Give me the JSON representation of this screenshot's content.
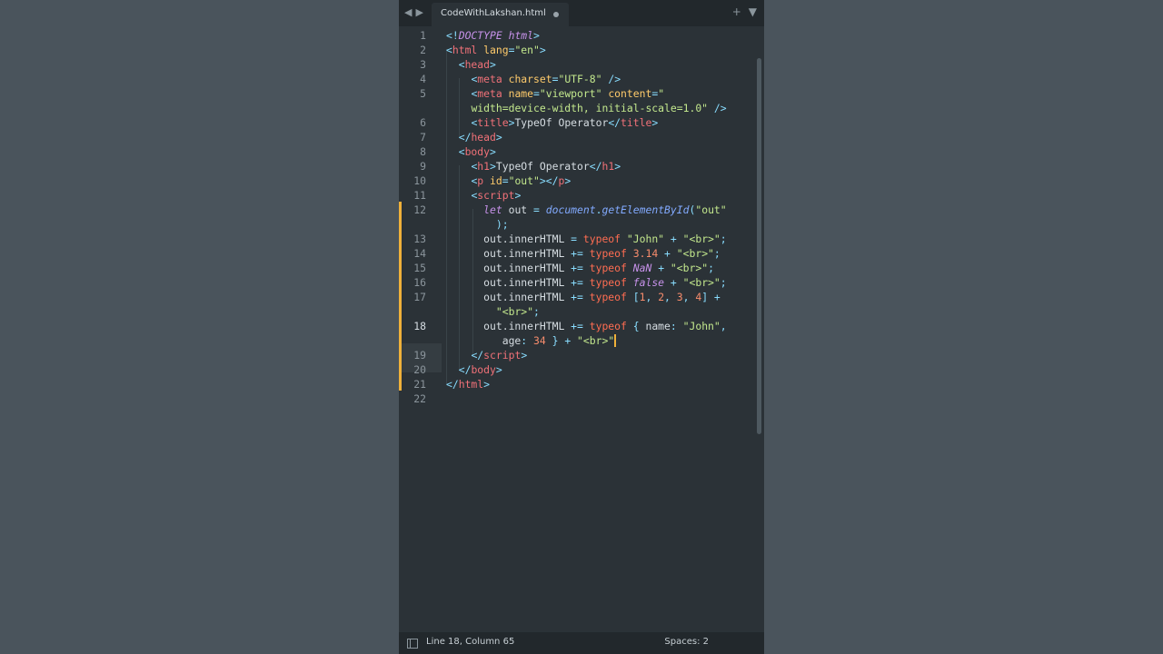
{
  "window": {
    "tab": {
      "title": "CodeWithLakshan.html"
    },
    "icons": [
      "back-arrow-icon",
      "forward-arrow-icon",
      "plus-icon",
      "chevron-down-icon",
      "panel-toggle-icon"
    ]
  },
  "status": {
    "position": "Line 18, Column 65",
    "indent": "Spaces: 2"
  },
  "colors": {
    "tag": "#f07178",
    "attribute": "#ffcb6b",
    "string": "#c3e88d",
    "keyword": "#ff6d52",
    "number": "#f78c6c",
    "modified_marker": "#f0b13a"
  },
  "code": {
    "lines": [
      {
        "num": "1",
        "parts": [
          [
            "p",
            "<!"
          ],
          [
            "i",
            "DOCTYPE"
          ],
          [
            "d",
            " "
          ],
          [
            "i",
            "html"
          ],
          [
            "p",
            ">"
          ]
        ]
      },
      {
        "num": "2",
        "parts": [
          [
            "p",
            "<"
          ],
          [
            "t",
            "html"
          ],
          [
            "d",
            " "
          ],
          [
            "a",
            "lang"
          ],
          [
            "p",
            "="
          ],
          [
            "s",
            "\"en\""
          ],
          [
            "p",
            ">"
          ]
        ]
      },
      {
        "num": "3",
        "parts": [
          [
            "d",
            "  "
          ],
          [
            "p",
            "<"
          ],
          [
            "t",
            "head"
          ],
          [
            "p",
            ">"
          ]
        ]
      },
      {
        "num": "4",
        "parts": [
          [
            "d",
            "    "
          ],
          [
            "p",
            "<"
          ],
          [
            "t",
            "meta"
          ],
          [
            "d",
            " "
          ],
          [
            "a",
            "charset"
          ],
          [
            "p",
            "="
          ],
          [
            "s",
            "\"UTF-8\""
          ],
          [
            "d",
            " "
          ],
          [
            "p",
            "/>"
          ]
        ]
      },
      {
        "num": "5",
        "parts": [
          [
            "d",
            "    "
          ],
          [
            "p",
            "<"
          ],
          [
            "t",
            "meta"
          ],
          [
            "d",
            " "
          ],
          [
            "a",
            "name"
          ],
          [
            "p",
            "="
          ],
          [
            "s",
            "\"viewport\""
          ],
          [
            "d",
            " "
          ],
          [
            "a",
            "content"
          ],
          [
            "p",
            "="
          ],
          [
            "s",
            "\""
          ]
        ]
      },
      {
        "num": "",
        "parts": [
          [
            "d",
            "    "
          ],
          [
            "s",
            "width=device-width, initial-scale=1.0\""
          ],
          [
            "d",
            " "
          ],
          [
            "p",
            "/>"
          ]
        ]
      },
      {
        "num": "6",
        "parts": [
          [
            "d",
            "    "
          ],
          [
            "p",
            "<"
          ],
          [
            "t",
            "title"
          ],
          [
            "p",
            ">"
          ],
          [
            "d",
            "TypeOf Operator"
          ],
          [
            "p",
            "</"
          ],
          [
            "t",
            "title"
          ],
          [
            "p",
            ">"
          ]
        ]
      },
      {
        "num": "7",
        "parts": [
          [
            "d",
            "  "
          ],
          [
            "p",
            "</"
          ],
          [
            "t",
            "head"
          ],
          [
            "p",
            ">"
          ]
        ]
      },
      {
        "num": "8",
        "parts": [
          [
            "d",
            "  "
          ],
          [
            "p",
            "<"
          ],
          [
            "t",
            "body"
          ],
          [
            "p",
            ">"
          ]
        ]
      },
      {
        "num": "9",
        "parts": [
          [
            "d",
            "    "
          ],
          [
            "p",
            "<"
          ],
          [
            "t",
            "h1"
          ],
          [
            "p",
            ">"
          ],
          [
            "d",
            "TypeOf Operator"
          ],
          [
            "p",
            "</"
          ],
          [
            "t",
            "h1"
          ],
          [
            "p",
            ">"
          ]
        ]
      },
      {
        "num": "10",
        "parts": [
          [
            "d",
            "    "
          ],
          [
            "p",
            "<"
          ],
          [
            "t",
            "p"
          ],
          [
            "d",
            " "
          ],
          [
            "a",
            "id"
          ],
          [
            "p",
            "="
          ],
          [
            "s",
            "\"out\""
          ],
          [
            "p",
            "></"
          ],
          [
            "t",
            "p"
          ],
          [
            "p",
            ">"
          ]
        ]
      },
      {
        "num": "11",
        "parts": [
          [
            "d",
            "    "
          ],
          [
            "p",
            "<"
          ],
          [
            "t",
            "script"
          ],
          [
            "p",
            ">"
          ]
        ]
      },
      {
        "num": "12",
        "parts": [
          [
            "d",
            "      "
          ],
          [
            "i",
            "let"
          ],
          [
            "d",
            " out "
          ],
          [
            "p",
            "="
          ],
          [
            "d",
            " "
          ],
          [
            "v",
            "document"
          ],
          [
            "p",
            "."
          ],
          [
            "v",
            "getElementById"
          ],
          [
            "p",
            "("
          ],
          [
            "s",
            "\"out\""
          ]
        ]
      },
      {
        "num": "",
        "parts": [
          [
            "d",
            "        "
          ],
          [
            "p",
            ");"
          ]
        ]
      },
      {
        "num": "13",
        "parts": [
          [
            "d",
            "      out.innerHTML "
          ],
          [
            "p",
            "="
          ],
          [
            "d",
            " "
          ],
          [
            "k",
            "typeof"
          ],
          [
            "d",
            " "
          ],
          [
            "s",
            "\"John\""
          ],
          [
            "d",
            " "
          ],
          [
            "p",
            "+"
          ],
          [
            "d",
            " "
          ],
          [
            "s",
            "\"<br>\""
          ],
          [
            "p",
            ";"
          ]
        ]
      },
      {
        "num": "14",
        "parts": [
          [
            "d",
            "      out.innerHTML "
          ],
          [
            "p",
            "+="
          ],
          [
            "d",
            " "
          ],
          [
            "k",
            "typeof"
          ],
          [
            "d",
            " "
          ],
          [
            "n",
            "3.14"
          ],
          [
            "d",
            " "
          ],
          [
            "p",
            "+"
          ],
          [
            "d",
            " "
          ],
          [
            "s",
            "\"<br>\""
          ],
          [
            "p",
            ";"
          ]
        ]
      },
      {
        "num": "15",
        "parts": [
          [
            "d",
            "      out.innerHTML "
          ],
          [
            "p",
            "+="
          ],
          [
            "d",
            " "
          ],
          [
            "k",
            "typeof"
          ],
          [
            "d",
            " "
          ],
          [
            "i",
            "NaN"
          ],
          [
            "d",
            " "
          ],
          [
            "p",
            "+"
          ],
          [
            "d",
            " "
          ],
          [
            "s",
            "\"<br>\""
          ],
          [
            "p",
            ";"
          ]
        ]
      },
      {
        "num": "16",
        "parts": [
          [
            "d",
            "      out.innerHTML "
          ],
          [
            "p",
            "+="
          ],
          [
            "d",
            " "
          ],
          [
            "k",
            "typeof"
          ],
          [
            "d",
            " "
          ],
          [
            "i",
            "false"
          ],
          [
            "d",
            " "
          ],
          [
            "p",
            "+"
          ],
          [
            "d",
            " "
          ],
          [
            "s",
            "\"<br>\""
          ],
          [
            "p",
            ";"
          ]
        ]
      },
      {
        "num": "17",
        "parts": [
          [
            "d",
            "      out.innerHTML "
          ],
          [
            "p",
            "+="
          ],
          [
            "d",
            " "
          ],
          [
            "k",
            "typeof"
          ],
          [
            "d",
            " "
          ],
          [
            "p",
            "["
          ],
          [
            "n",
            "1"
          ],
          [
            "p",
            ","
          ],
          [
            "d",
            " "
          ],
          [
            "n",
            "2"
          ],
          [
            "p",
            ","
          ],
          [
            "d",
            " "
          ],
          [
            "n",
            "3"
          ],
          [
            "p",
            ","
          ],
          [
            "d",
            " "
          ],
          [
            "n",
            "4"
          ],
          [
            "p",
            "]"
          ],
          [
            "d",
            " "
          ],
          [
            "p",
            "+"
          ]
        ]
      },
      {
        "num": "",
        "parts": [
          [
            "d",
            "        "
          ],
          [
            "s",
            "\"<br>\""
          ],
          [
            "p",
            ";"
          ]
        ]
      },
      {
        "num": "18",
        "parts": [
          [
            "d",
            "      out.innerHTML "
          ],
          [
            "p",
            "+="
          ],
          [
            "d",
            " "
          ],
          [
            "k",
            "typeof"
          ],
          [
            "d",
            " "
          ],
          [
            "p",
            "{"
          ],
          [
            "d",
            " name"
          ],
          [
            "p",
            ":"
          ],
          [
            "d",
            " "
          ],
          [
            "s",
            "\"John\""
          ],
          [
            "p",
            ","
          ]
        ]
      },
      {
        "num": "",
        "parts": [
          [
            "d",
            "         age"
          ],
          [
            "p",
            ":"
          ],
          [
            "d",
            " "
          ],
          [
            "n",
            "34"
          ],
          [
            "d",
            " "
          ],
          [
            "p",
            "}"
          ],
          [
            "d",
            " "
          ],
          [
            "p",
            "+"
          ],
          [
            "d",
            " "
          ],
          [
            "s",
            "\"<br>\""
          ]
        ]
      },
      {
        "num": "19",
        "parts": [
          [
            "d",
            "    "
          ],
          [
            "p",
            "</"
          ],
          [
            "t",
            "script"
          ],
          [
            "p",
            ">"
          ]
        ]
      },
      {
        "num": "20",
        "parts": [
          [
            "d",
            "  "
          ],
          [
            "p",
            "</"
          ],
          [
            "t",
            "body"
          ],
          [
            "p",
            ">"
          ]
        ]
      },
      {
        "num": "21",
        "parts": [
          [
            "p",
            "</"
          ],
          [
            "t",
            "html"
          ],
          [
            "p",
            ">"
          ]
        ]
      },
      {
        "num": "22",
        "parts": []
      }
    ]
  }
}
